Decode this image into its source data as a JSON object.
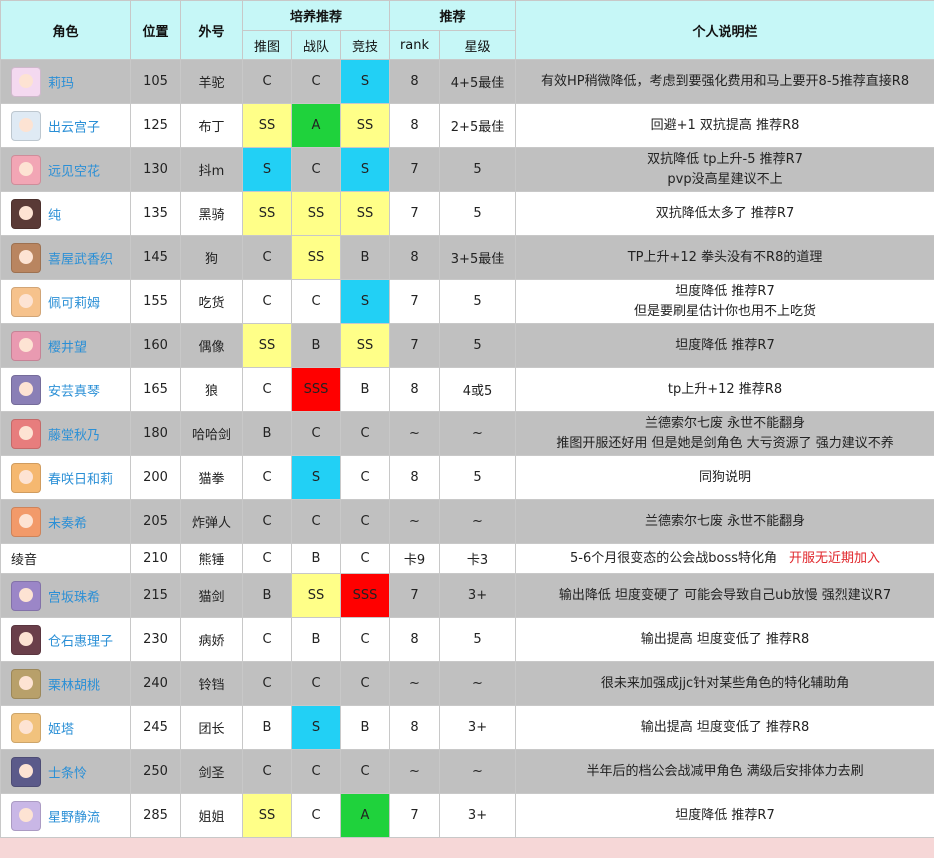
{
  "header": {
    "role": "角色",
    "position": "位置",
    "nickname": "外号",
    "training": "培养推荐",
    "recommend": "推荐",
    "notes": "个人说明栏",
    "sub": {
      "push": "推图",
      "team": "战队",
      "arena": "竞技",
      "rank": "rank",
      "star": "星级"
    }
  },
  "rating_colors": {
    "SSS": "#ff0000",
    "SS": "#ffff88",
    "S": "#22d0f5",
    "A": "#1fd23c"
  },
  "rows": [
    {
      "name": "莉玛",
      "link": true,
      "avatar": "#f4d9f0",
      "pos": "105",
      "nick": "羊驼",
      "push": "C",
      "team": "C",
      "arena": "S",
      "rank": "8",
      "star": "4+5最佳",
      "notes": [
        "有效HP稍微降低，考虑到要强化费用和马上要开8-5推荐直接R8"
      ],
      "bg": "gray"
    },
    {
      "name": "出云宫子",
      "link": true,
      "avatar": "#dfeaf4",
      "pos": "125",
      "nick": "布丁",
      "push": "SS",
      "team": "A",
      "arena": "SS",
      "rank": "8",
      "star": "2+5最佳",
      "notes": [
        "回避+1 双抗提高 推荐R8"
      ],
      "bg": "white"
    },
    {
      "name": "远见空花",
      "link": true,
      "avatar": "#f2a6b5",
      "pos": "130",
      "nick": "抖m",
      "push": "S",
      "team": "C",
      "arena": "S",
      "rank": "7",
      "star": "5",
      "notes": [
        "双抗降低 tp上升-5 推荐R7",
        "pvp没高星建议不上"
      ],
      "bg": "gray"
    },
    {
      "name": "纯",
      "link": true,
      "avatar": "#5a3a36",
      "pos": "135",
      "nick": "黑骑",
      "push": "SS",
      "team": "SS",
      "arena": "SS",
      "rank": "7",
      "star": "5",
      "notes": [
        "双抗降低太多了 推荐R7"
      ],
      "bg": "white"
    },
    {
      "name": "喜屋武香织",
      "link": true,
      "avatar": "#b98560",
      "pos": "145",
      "nick": "狗",
      "push": "C",
      "team": "SS",
      "arena": "B",
      "rank": "8",
      "star": "3+5最佳",
      "notes": [
        "TP上升+12 拳头没有不R8的道理"
      ],
      "bg": "gray"
    },
    {
      "name": "佩可莉姆",
      "link": true,
      "avatar": "#f6c28c",
      "pos": "155",
      "nick": "吃货",
      "push": "C",
      "team": "C",
      "arena": "S",
      "rank": "7",
      "star": "5",
      "notes": [
        "坦度降低 推荐R7",
        "但是要刷星估计你也用不上吃货"
      ],
      "bg": "white"
    },
    {
      "name": "樱井望",
      "link": true,
      "avatar": "#e99ab1",
      "pos": "160",
      "nick": "偶像",
      "push": "SS",
      "team": "B",
      "arena": "SS",
      "rank": "7",
      "star": "5",
      "notes": [
        "坦度降低 推荐R7"
      ],
      "bg": "gray"
    },
    {
      "name": "安芸真琴",
      "link": true,
      "avatar": "#8a7fb6",
      "pos": "165",
      "nick": "狼",
      "push": "C",
      "team": "SSS",
      "arena": "B",
      "rank": "8",
      "star": "4或5",
      "notes": [
        "tp上升+12 推荐R8"
      ],
      "bg": "white"
    },
    {
      "name": "藤堂秋乃",
      "link": true,
      "avatar": "#e77d7d",
      "pos": "180",
      "nick": "哈哈剑",
      "push": "B",
      "team": "C",
      "arena": "C",
      "rank": "~",
      "star": "~",
      "notes": [
        "兰德索尔七废 永世不能翻身",
        "推图开服还好用 但是她是剑角色 大亏资源了 强力建议不养"
      ],
      "bg": "gray"
    },
    {
      "name": "春咲日和莉",
      "link": true,
      "avatar": "#f5b870",
      "pos": "200",
      "nick": "猫拳",
      "push": "C",
      "team": "S",
      "arena": "C",
      "rank": "8",
      "star": "5",
      "notes": [
        "同狗说明"
      ],
      "bg": "white"
    },
    {
      "name": "未奏希",
      "link": true,
      "avatar": "#f29a6a",
      "pos": "205",
      "nick": "炸弹人",
      "push": "C",
      "team": "C",
      "arena": "C",
      "rank": "~",
      "star": "~",
      "notes": [
        "兰德索尔七废 永世不能翻身"
      ],
      "bg": "gray"
    },
    {
      "name": "绫音",
      "link": false,
      "avatar": "",
      "pos": "210",
      "nick": "熊锤",
      "push": "C",
      "team": "B",
      "arena": "C",
      "rank": "卡9",
      "star": "卡3",
      "notes": [
        "5-6个月很变态的公会战boss特化角"
      ],
      "note_extra": "开服无近期加入",
      "bg": "white",
      "short": true
    },
    {
      "name": "宫坂珠希",
      "link": true,
      "avatar": "#9b86c7",
      "pos": "215",
      "nick": "猫剑",
      "push": "B",
      "team": "SS",
      "arena": "SSS",
      "rank": "7",
      "star": "3+",
      "notes": [
        "输出降低 坦度变硬了 可能会导致自己ub放慢 强烈建议R7"
      ],
      "bg": "gray"
    },
    {
      "name": "仓石惠理子",
      "link": true,
      "avatar": "#6a3f4a",
      "pos": "230",
      "nick": "病娇",
      "push": "C",
      "team": "B",
      "arena": "C",
      "rank": "8",
      "star": "5",
      "notes": [
        "输出提高 坦度变低了 推荐R8"
      ],
      "bg": "white"
    },
    {
      "name": "栗林胡桃",
      "link": true,
      "avatar": "#b8a06a",
      "pos": "240",
      "nick": "铃铛",
      "push": "C",
      "team": "C",
      "arena": "C",
      "rank": "~",
      "star": "~",
      "notes": [
        "很未来加强成jjc针对某些角色的特化辅助角"
      ],
      "bg": "gray"
    },
    {
      "name": "姬塔",
      "link": true,
      "avatar": "#f1c27d",
      "pos": "245",
      "nick": "团长",
      "push": "B",
      "team": "S",
      "arena": "B",
      "rank": "8",
      "star": "3+",
      "notes": [
        "输出提高 坦度变低了 推荐R8"
      ],
      "bg": "white"
    },
    {
      "name": "士条怜",
      "link": true,
      "avatar": "#5b5a8a",
      "pos": "250",
      "nick": "剑圣",
      "push": "C",
      "team": "C",
      "arena": "C",
      "rank": "~",
      "star": "~",
      "notes": [
        "半年后的档公会战减甲角色 满级后安排体力去刷"
      ],
      "bg": "gray"
    },
    {
      "name": "星野静流",
      "link": true,
      "avatar": "#c9b7e6",
      "pos": "285",
      "nick": "姐姐",
      "push": "SS",
      "team": "C",
      "arena": "A",
      "rank": "7",
      "star": "3+",
      "notes": [
        "坦度降低 推荐R7"
      ],
      "bg": "white"
    }
  ]
}
